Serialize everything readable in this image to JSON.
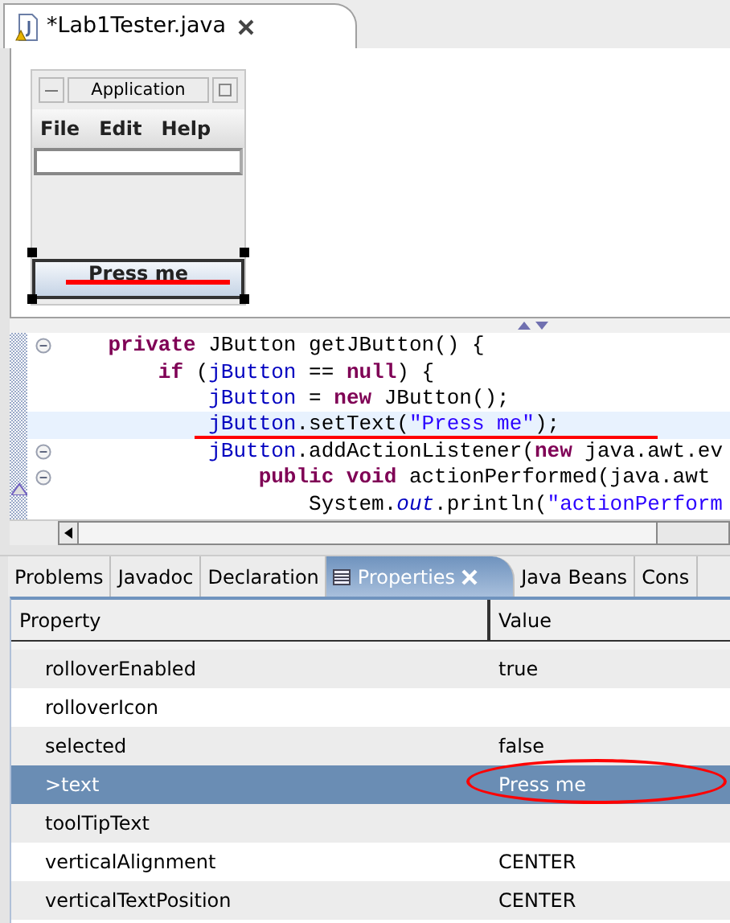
{
  "editor_tab": {
    "title": "*Lab1Tester.java",
    "selected": true
  },
  "app_window": {
    "title": "Application",
    "menu": [
      "File",
      "Edit",
      "Help"
    ],
    "button_label": "Press me"
  },
  "code_lines": [
    {
      "fold": true,
      "highlighted": false,
      "segments": [
        {
          "kind": "keyword",
          "text": "    private"
        },
        {
          "kind": "plain",
          "text": " JButton getJButton() {"
        }
      ]
    },
    {
      "fold": false,
      "highlighted": false,
      "segments": [
        {
          "kind": "keyword",
          "text": "        if"
        },
        {
          "kind": "plain",
          "text": " ("
        },
        {
          "kind": "field",
          "text": "jButton"
        },
        {
          "kind": "plain",
          "text": " == "
        },
        {
          "kind": "keyword",
          "text": "null"
        },
        {
          "kind": "plain",
          "text": ") {"
        }
      ]
    },
    {
      "fold": false,
      "highlighted": false,
      "segments": [
        {
          "kind": "field",
          "text": "            jButton"
        },
        {
          "kind": "plain",
          "text": " = "
        },
        {
          "kind": "keyword",
          "text": "new"
        },
        {
          "kind": "plain",
          "text": " JButton();"
        }
      ]
    },
    {
      "fold": false,
      "highlighted": true,
      "segments": [
        {
          "kind": "field",
          "text": "            jButton"
        },
        {
          "kind": "plain",
          "text": ".setText("
        },
        {
          "kind": "string",
          "text": "\"Press me\""
        },
        {
          "kind": "plain",
          "text": ");"
        }
      ]
    },
    {
      "fold": true,
      "highlighted": false,
      "segments": [
        {
          "kind": "field",
          "text": "            jButton"
        },
        {
          "kind": "plain",
          "text": ".addActionListener("
        },
        {
          "kind": "keyword",
          "text": "new"
        },
        {
          "kind": "plain",
          "text": " java.awt.ev"
        }
      ]
    },
    {
      "fold": true,
      "highlighted": false,
      "segments": [
        {
          "kind": "keyword",
          "text": "                public void"
        },
        {
          "kind": "plain",
          "text": " actionPerformed(java.awt"
        }
      ]
    },
    {
      "fold": false,
      "highlighted": false,
      "segments": [
        {
          "kind": "plain",
          "text": "                    System."
        },
        {
          "kind": "field",
          "text": "out"
        },
        {
          "kind": "plain",
          "text": ".println("
        },
        {
          "kind": "string",
          "text": "\"actionPerform"
        }
      ]
    }
  ],
  "panel_tabs": [
    {
      "label": "Problems",
      "selected": false
    },
    {
      "label": "Javadoc",
      "selected": false
    },
    {
      "label": "Declaration",
      "selected": false
    },
    {
      "label": "Properties",
      "selected": true
    },
    {
      "label": "Java Beans",
      "selected": false
    },
    {
      "label": "Cons",
      "selected": false
    }
  ],
  "table": {
    "columns": [
      "Property",
      "Value"
    ],
    "rows": [
      {
        "property": "rolloverEnabled",
        "value": "true",
        "selected": false
      },
      {
        "property": "rolloverIcon",
        "selected": false
      },
      {
        "property": "selected",
        "value": "false",
        "selected": false
      },
      {
        "property": ">text",
        "value": "Press me",
        "selected": true
      },
      {
        "property": "toolTipText",
        "selected": false
      },
      {
        "property": "verticalAlignment",
        "value": "CENTER",
        "selected": false
      },
      {
        "property": "verticalTextPosition",
        "value": "CENTER",
        "selected": false
      }
    ]
  }
}
